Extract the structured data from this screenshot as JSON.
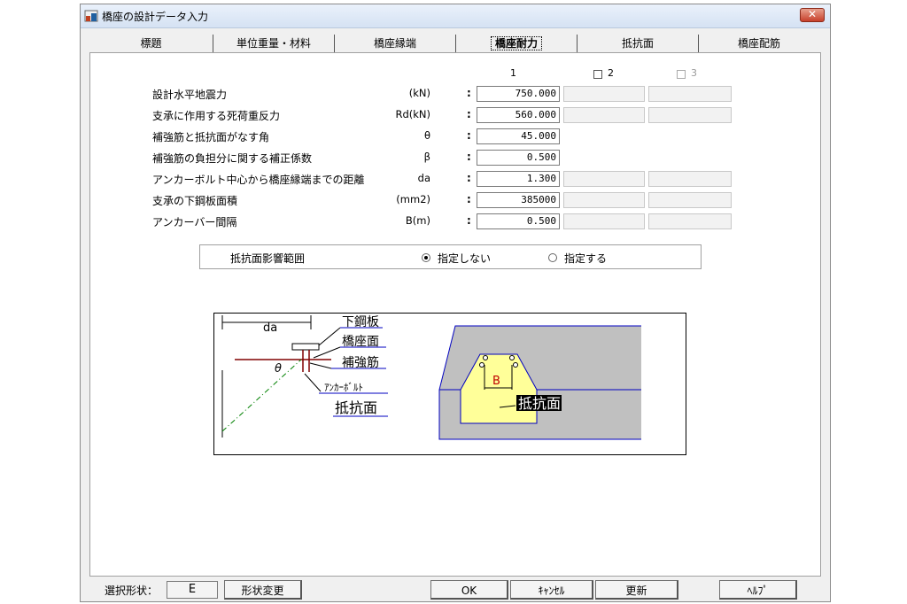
{
  "window": {
    "title": "橋座の設計データ入力",
    "close_label": "✕"
  },
  "tabs": [
    {
      "label": "標題"
    },
    {
      "label": "単位重量・材料"
    },
    {
      "label": "橋座縁端"
    },
    {
      "label": "橋座耐力"
    },
    {
      "label": "抵抗面"
    },
    {
      "label": "橋座配筋"
    }
  ],
  "columns": {
    "c1": "1",
    "c2": "2",
    "c3": "3"
  },
  "rows": [
    {
      "label": "設計水平地震力",
      "unit": "(kN)",
      "v1": "750.000",
      "v2": "",
      "v3": ""
    },
    {
      "label": "支承に作用する死荷重反力",
      "unit": "Rd(kN)",
      "v1": "560.000",
      "v2": "",
      "v3": ""
    },
    {
      "label": "補強筋と抵抗面がなす角",
      "unit": "θ",
      "v1": "45.000"
    },
    {
      "label": "補強筋の負担分に関する補正係数",
      "unit": "β",
      "v1": "0.500"
    },
    {
      "label": "アンカーボルト中心から橋座縁端までの距離",
      "unit": "da",
      "v1": "1.300",
      "v2": "",
      "v3": ""
    },
    {
      "label": "支承の下鋼板面積",
      "unit": "(mm2)",
      "v1": "385000",
      "v2": "",
      "v3": ""
    },
    {
      "label": "アンカーバー間隔",
      "unit": "B(m)",
      "v1": "0.500",
      "v2": "",
      "v3": ""
    }
  ],
  "colon": ":",
  "range": {
    "label": "抵抗面影響範囲",
    "opt_no": "指定しない",
    "opt_yes": "指定する",
    "selected": "指定しない"
  },
  "figure": {
    "da": "da",
    "plate": "下鋼板",
    "seat": "橋座面",
    "rebar": "補強筋",
    "anchor": "ｱﾝｶｰﾎﾞﾙﾄ",
    "resist": "抵抗面",
    "theta": "θ",
    "b": "B",
    "resist_right": "抵抗面",
    "colors": {
      "concrete": "#c0c0c0",
      "wedge": "#ffff99",
      "line": "#0000c0",
      "rebar": "#800000",
      "dash": "#008000"
    }
  },
  "footer": {
    "shape_label": "選択形状：",
    "shape_value": "E",
    "change_shape": "形状変更",
    "ok": "OK",
    "cancel": "ｷｬﾝｾﾙ",
    "update": "更新",
    "help": "ﾍﾙﾌﾟ"
  }
}
